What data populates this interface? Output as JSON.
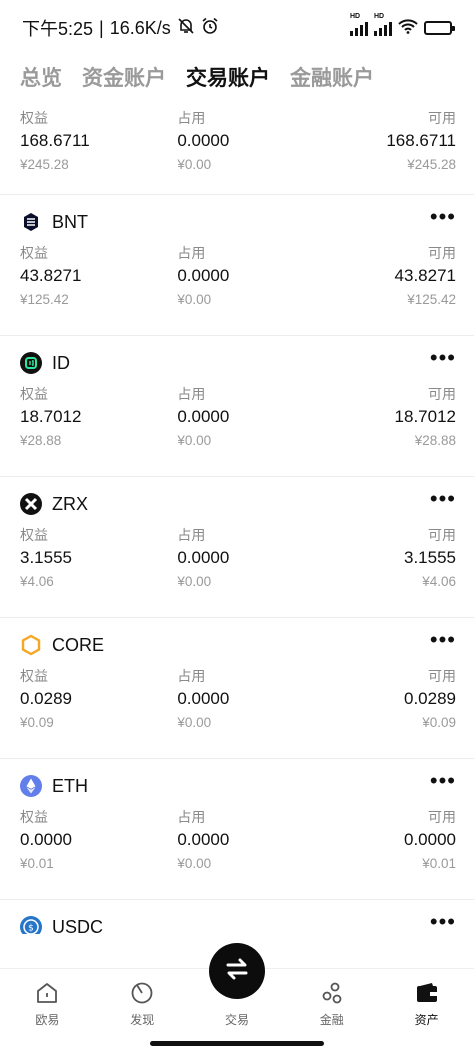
{
  "status": {
    "time": "下午5:25",
    "speed": "16.6K/s",
    "battery": "⚡"
  },
  "tabs": [
    "总览",
    "资金账户",
    "交易账户",
    "金融账户"
  ],
  "active_tab": 2,
  "columns": {
    "equity": "权益",
    "occupied": "占用",
    "available": "可用"
  },
  "assets": [
    {
      "name": "",
      "icon": "none",
      "equity": "168.6711",
      "equity_cny": "¥245.28",
      "occupied": "0.0000",
      "occupied_cny": "¥0.00",
      "available": "168.6711",
      "available_cny": "¥245.28"
    },
    {
      "name": "BNT",
      "icon": "bnt-icon",
      "equity": "43.8271",
      "equity_cny": "¥125.42",
      "occupied": "0.0000",
      "occupied_cny": "¥0.00",
      "available": "43.8271",
      "available_cny": "¥125.42",
      "more": "•••"
    },
    {
      "name": "ID",
      "icon": "id-icon",
      "equity": "18.7012",
      "equity_cny": "¥28.88",
      "occupied": "0.0000",
      "occupied_cny": "¥0.00",
      "available": "18.7012",
      "available_cny": "¥28.88",
      "more": "•••"
    },
    {
      "name": "ZRX",
      "icon": "zrx-icon",
      "equity": "3.1555",
      "equity_cny": "¥4.06",
      "occupied": "0.0000",
      "occupied_cny": "¥0.00",
      "available": "3.1555",
      "available_cny": "¥4.06",
      "more": "•••"
    },
    {
      "name": "CORE",
      "icon": "core-icon",
      "equity": "0.0289",
      "equity_cny": "¥0.09",
      "occupied": "0.0000",
      "occupied_cny": "¥0.00",
      "available": "0.0289",
      "available_cny": "¥0.09",
      "more": "•••"
    },
    {
      "name": "ETH",
      "icon": "eth-icon",
      "equity": "0.0000",
      "equity_cny": "¥0.01",
      "occupied": "0.0000",
      "occupied_cny": "¥0.00",
      "available": "0.0000",
      "available_cny": "¥0.01",
      "more": "•••"
    },
    {
      "name": "USDC",
      "icon": "usdc-icon",
      "more": "•••"
    }
  ],
  "nav": [
    {
      "label": "欧易",
      "icon": "home-icon"
    },
    {
      "label": "发现",
      "icon": "discover-icon"
    },
    {
      "label": "交易",
      "icon": "trade-swap-icon"
    },
    {
      "label": "金融",
      "icon": "finance-icon"
    },
    {
      "label": "资产",
      "icon": "wallet-icon"
    }
  ],
  "active_nav": 4
}
